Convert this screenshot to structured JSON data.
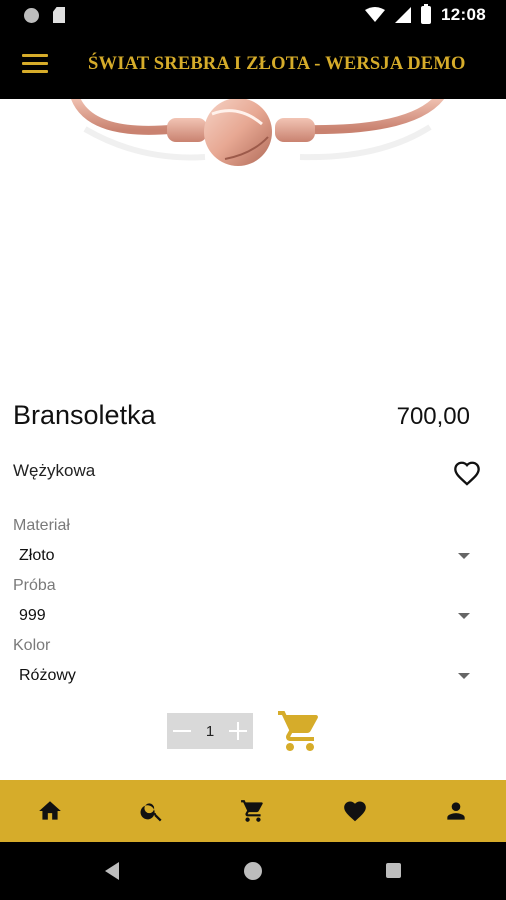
{
  "status_bar": {
    "time": "12:08"
  },
  "app_bar": {
    "title": "ŚWIAT SREBRA I ZŁOTA - WERSJA DEMO"
  },
  "product": {
    "name": "Bransoletka",
    "price": "700,00",
    "subtitle": "Wężykowa"
  },
  "options": [
    {
      "label": "Materiał",
      "value": "Złoto"
    },
    {
      "label": "Próba",
      "value": "999"
    },
    {
      "label": "Kolor",
      "value": "Różowy"
    }
  ],
  "quantity": {
    "value": "1"
  },
  "bottom_nav": {
    "items": [
      {
        "icon": "home-icon"
      },
      {
        "icon": "search-icon"
      },
      {
        "icon": "cart-icon"
      },
      {
        "icon": "heart-icon"
      },
      {
        "icon": "account-icon"
      }
    ]
  },
  "colors": {
    "accent": "#d6ac2a",
    "app_bar_bg": "#000000",
    "bracelet": "#e6a592"
  }
}
